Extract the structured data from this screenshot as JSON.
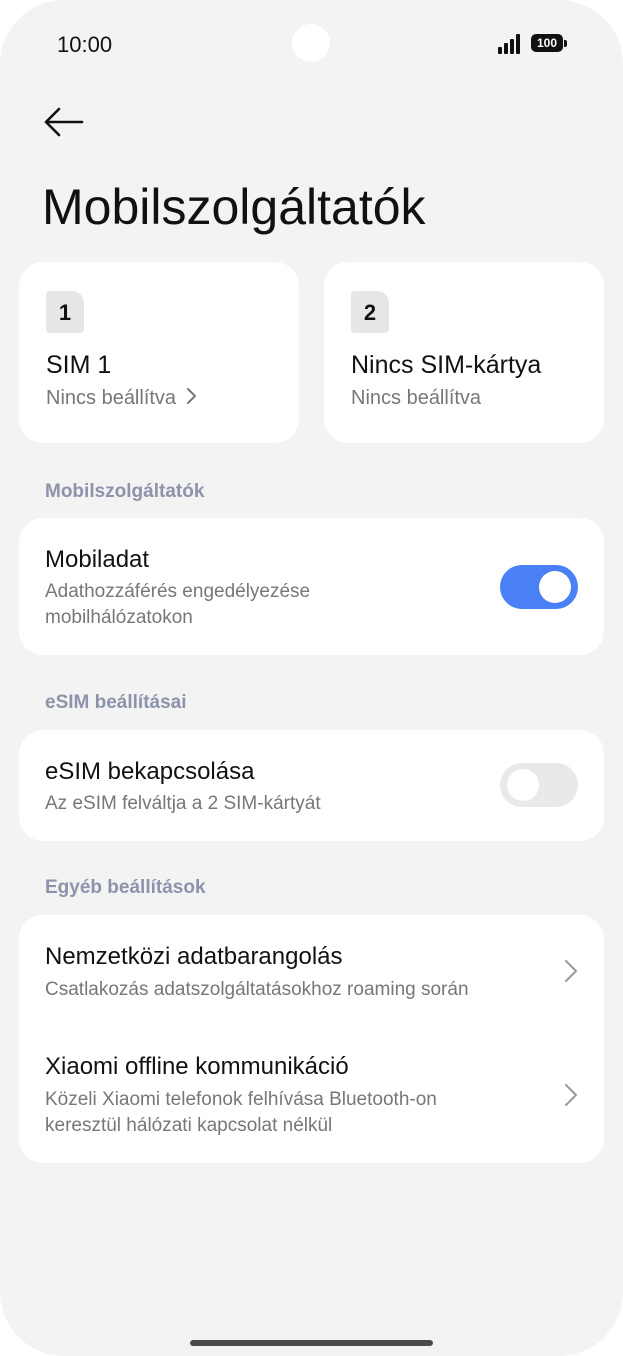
{
  "status_bar": {
    "time": "10:00",
    "battery": "100"
  },
  "header": {
    "title": "Mobilszolgáltatók",
    "back_icon": "arrow-left-icon"
  },
  "sim_cards": [
    {
      "number": "1",
      "name": "SIM 1",
      "status": "Nincs beállítva",
      "has_chevron": true
    },
    {
      "number": "2",
      "name": "Nincs SIM-kártya",
      "status": "Nincs beállítva",
      "has_chevron": false
    }
  ],
  "sections": {
    "mobile": {
      "label": "Mobilszolgáltatók",
      "mobile_data": {
        "title": "Mobiladat",
        "subtitle_line1": "Adathozzáférés engedélyezése",
        "subtitle_line2": "mobilhálózatokon",
        "enabled": true
      }
    },
    "esim": {
      "label": "eSIM beállításai",
      "esim_toggle": {
        "title": "eSIM bekapcsolása",
        "subtitle": "Az eSIM felváltja a 2 SIM-kártyát",
        "enabled": false
      }
    },
    "other": {
      "label": "Egyéb beállítások",
      "roaming": {
        "title": "Nemzetközi adatbarangolás",
        "subtitle": "Csatlakozás adatszolgáltatásokhoz roaming során"
      },
      "offline": {
        "title": "Xiaomi offline kommunikáció",
        "subtitle_line1": "Közeli Xiaomi telefonok felhívása Bluetooth-on",
        "subtitle_line2": "keresztül hálózati kapcsolat nélkül"
      }
    }
  },
  "colors": {
    "accent": "#4a80f5",
    "section_label": "#8d93aa",
    "background": "#f3f3f3"
  }
}
